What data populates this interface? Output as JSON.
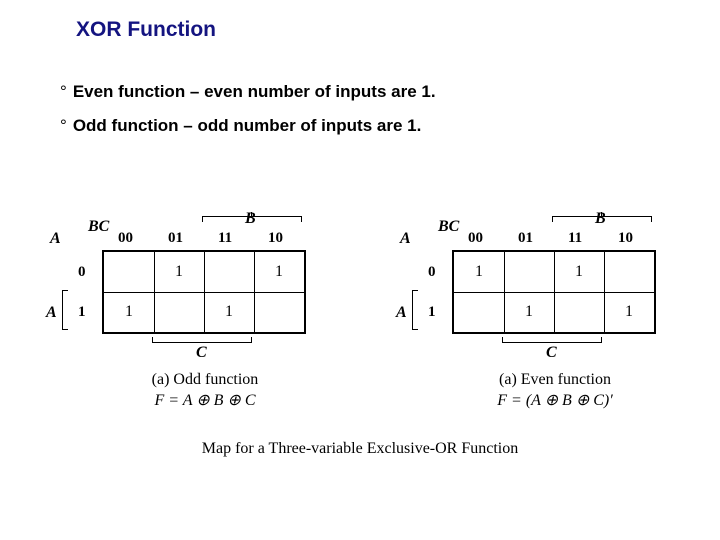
{
  "title": "XOR Function",
  "bullets": [
    "Even function – even number of inputs are 1.",
    "Odd function – odd number of inputs are 1."
  ],
  "labels": {
    "A": "A",
    "B": "B",
    "C": "C",
    "BC": "BC",
    "cols": [
      "00",
      "01",
      "11",
      "10"
    ],
    "rows": [
      "0",
      "1"
    ]
  },
  "left": {
    "cells": {
      "r0c0": "",
      "r0c1": "1",
      "r0c2": "",
      "r0c3": "1",
      "r1c0": "1",
      "r1c1": "",
      "r1c2": "1",
      "r1c3": ""
    },
    "caption_a": "(a) Odd function",
    "caption_f": "F = A ⊕ B ⊕ C"
  },
  "right": {
    "cells": {
      "r0c0": "1",
      "r0c1": "",
      "r0c2": "1",
      "r0c3": "",
      "r1c0": "",
      "r1c1": "1",
      "r1c2": "",
      "r1c3": "1"
    },
    "caption_a": "(a) Even function",
    "caption_f": "F = (A ⊕ B ⊕ C)′"
  },
  "footer": "Map for a Three-variable Exclusive-OR Function",
  "chart_data": [
    {
      "type": "table",
      "title": "Odd function K-map (F = A⊕B⊕C)",
      "row_label": "A",
      "col_label": "BC",
      "cols": [
        "00",
        "01",
        "11",
        "10"
      ],
      "rows": [
        "0",
        "1"
      ],
      "values": [
        [
          0,
          1,
          0,
          1
        ],
        [
          1,
          0,
          1,
          0
        ]
      ]
    },
    {
      "type": "table",
      "title": "Even function K-map (F = (A⊕B⊕C)′)",
      "row_label": "A",
      "col_label": "BC",
      "cols": [
        "00",
        "01",
        "11",
        "10"
      ],
      "rows": [
        "0",
        "1"
      ],
      "values": [
        [
          1,
          0,
          1,
          0
        ],
        [
          0,
          1,
          0,
          1
        ]
      ]
    }
  ]
}
